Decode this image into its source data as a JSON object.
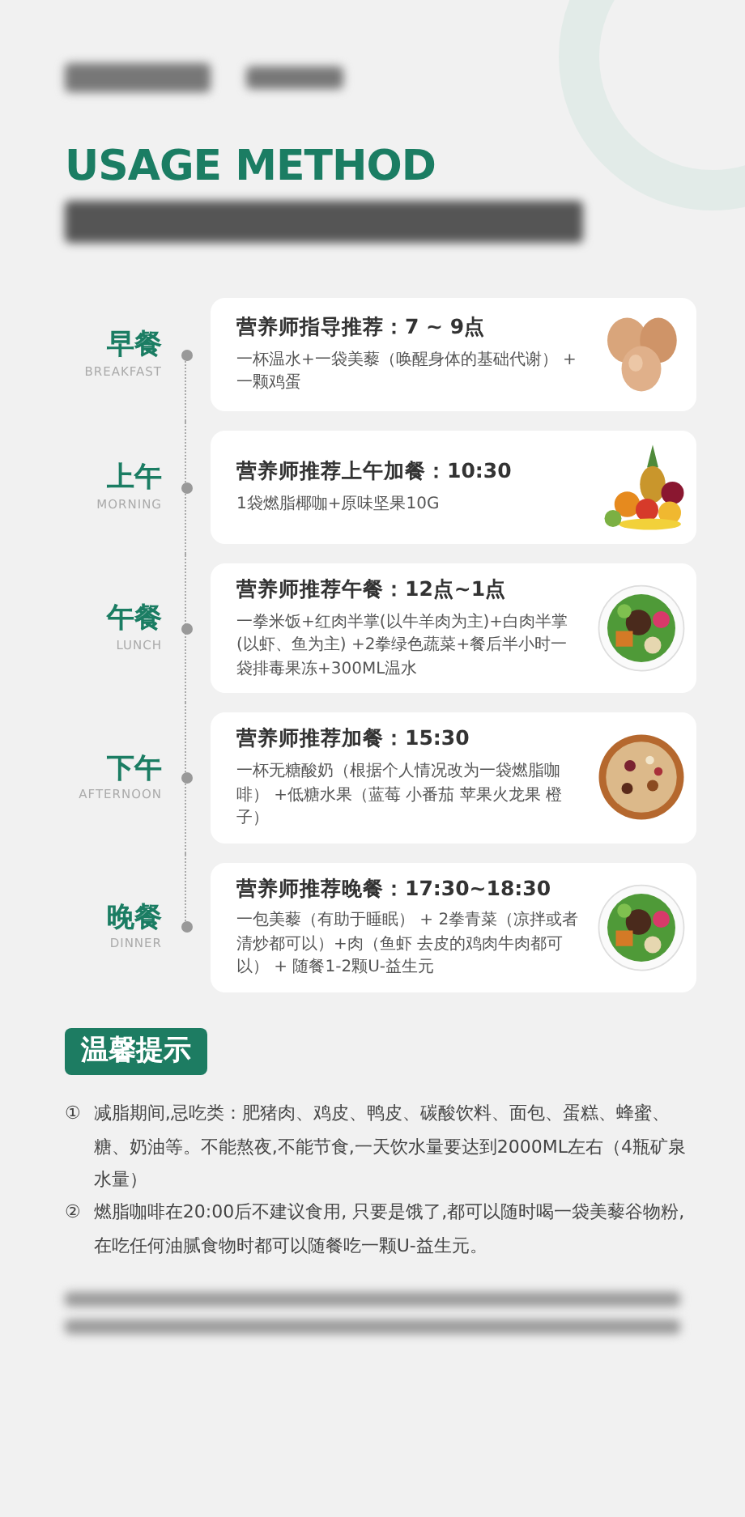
{
  "heading": {
    "title": "USAGE METHOD"
  },
  "meals": [
    {
      "name": "早餐",
      "name_en": "BREAKFAST",
      "title": "营养师指导推荐：7 ~ 9点",
      "text": "一杯温水+一袋美藜（唤醒身体的基础代谢） + 一颗鸡蛋"
    },
    {
      "name": "上午",
      "name_en": "MORNING",
      "title": "营养师推荐上午加餐：10:30",
      "text": "1袋燃脂椰咖+原味坚果10G"
    },
    {
      "name": "午餐",
      "name_en": "LUNCH",
      "title": "营养师推荐午餐：12点~1点",
      "text": "一拳米饭+红肉半掌(以牛羊肉为主)+白肉半掌(以虾、鱼为主) +2拳绿色蔬菜+餐后半小时一袋排毒果冻+300ML温水"
    },
    {
      "name": "下午",
      "name_en": "AFTERNOON",
      "title": "营养师推荐加餐：15:30",
      "text": "一杯无糖酸奶（根据个人情况改为一袋燃脂咖啡） +低糖水果（蓝莓 小番茄 苹果火龙果 橙子）"
    },
    {
      "name": "晚餐",
      "name_en": "DINNER",
      "title": "营养师推荐晚餐：17:30~18:30",
      "text": "一包美藜（有助于睡眠） + 2拳青菜（凉拌或者清炒都可以）+肉（鱼虾 去皮的鸡肉牛肉都可以） + 随餐1-2颗U-益生元"
    }
  ],
  "tips": {
    "title": "温馨提示",
    "items": [
      {
        "number": "①",
        "text": "减脂期间,忌吃类：肥猪肉、鸡皮、鸭皮、碳酸饮料、面包、蛋糕、蜂蜜、糖、奶油等。不能熬夜,不能节食,一天饮水量要达到2000ML左右（4瓶矿泉水量）"
      },
      {
        "number": "②",
        "text": "燃脂咖啡在20:00后不建议食用, 只要是饿了,都可以随时喝一袋美藜谷物粉, 在吃任何油腻食物时都可以随餐吃一颗U-益生元。"
      }
    ]
  }
}
